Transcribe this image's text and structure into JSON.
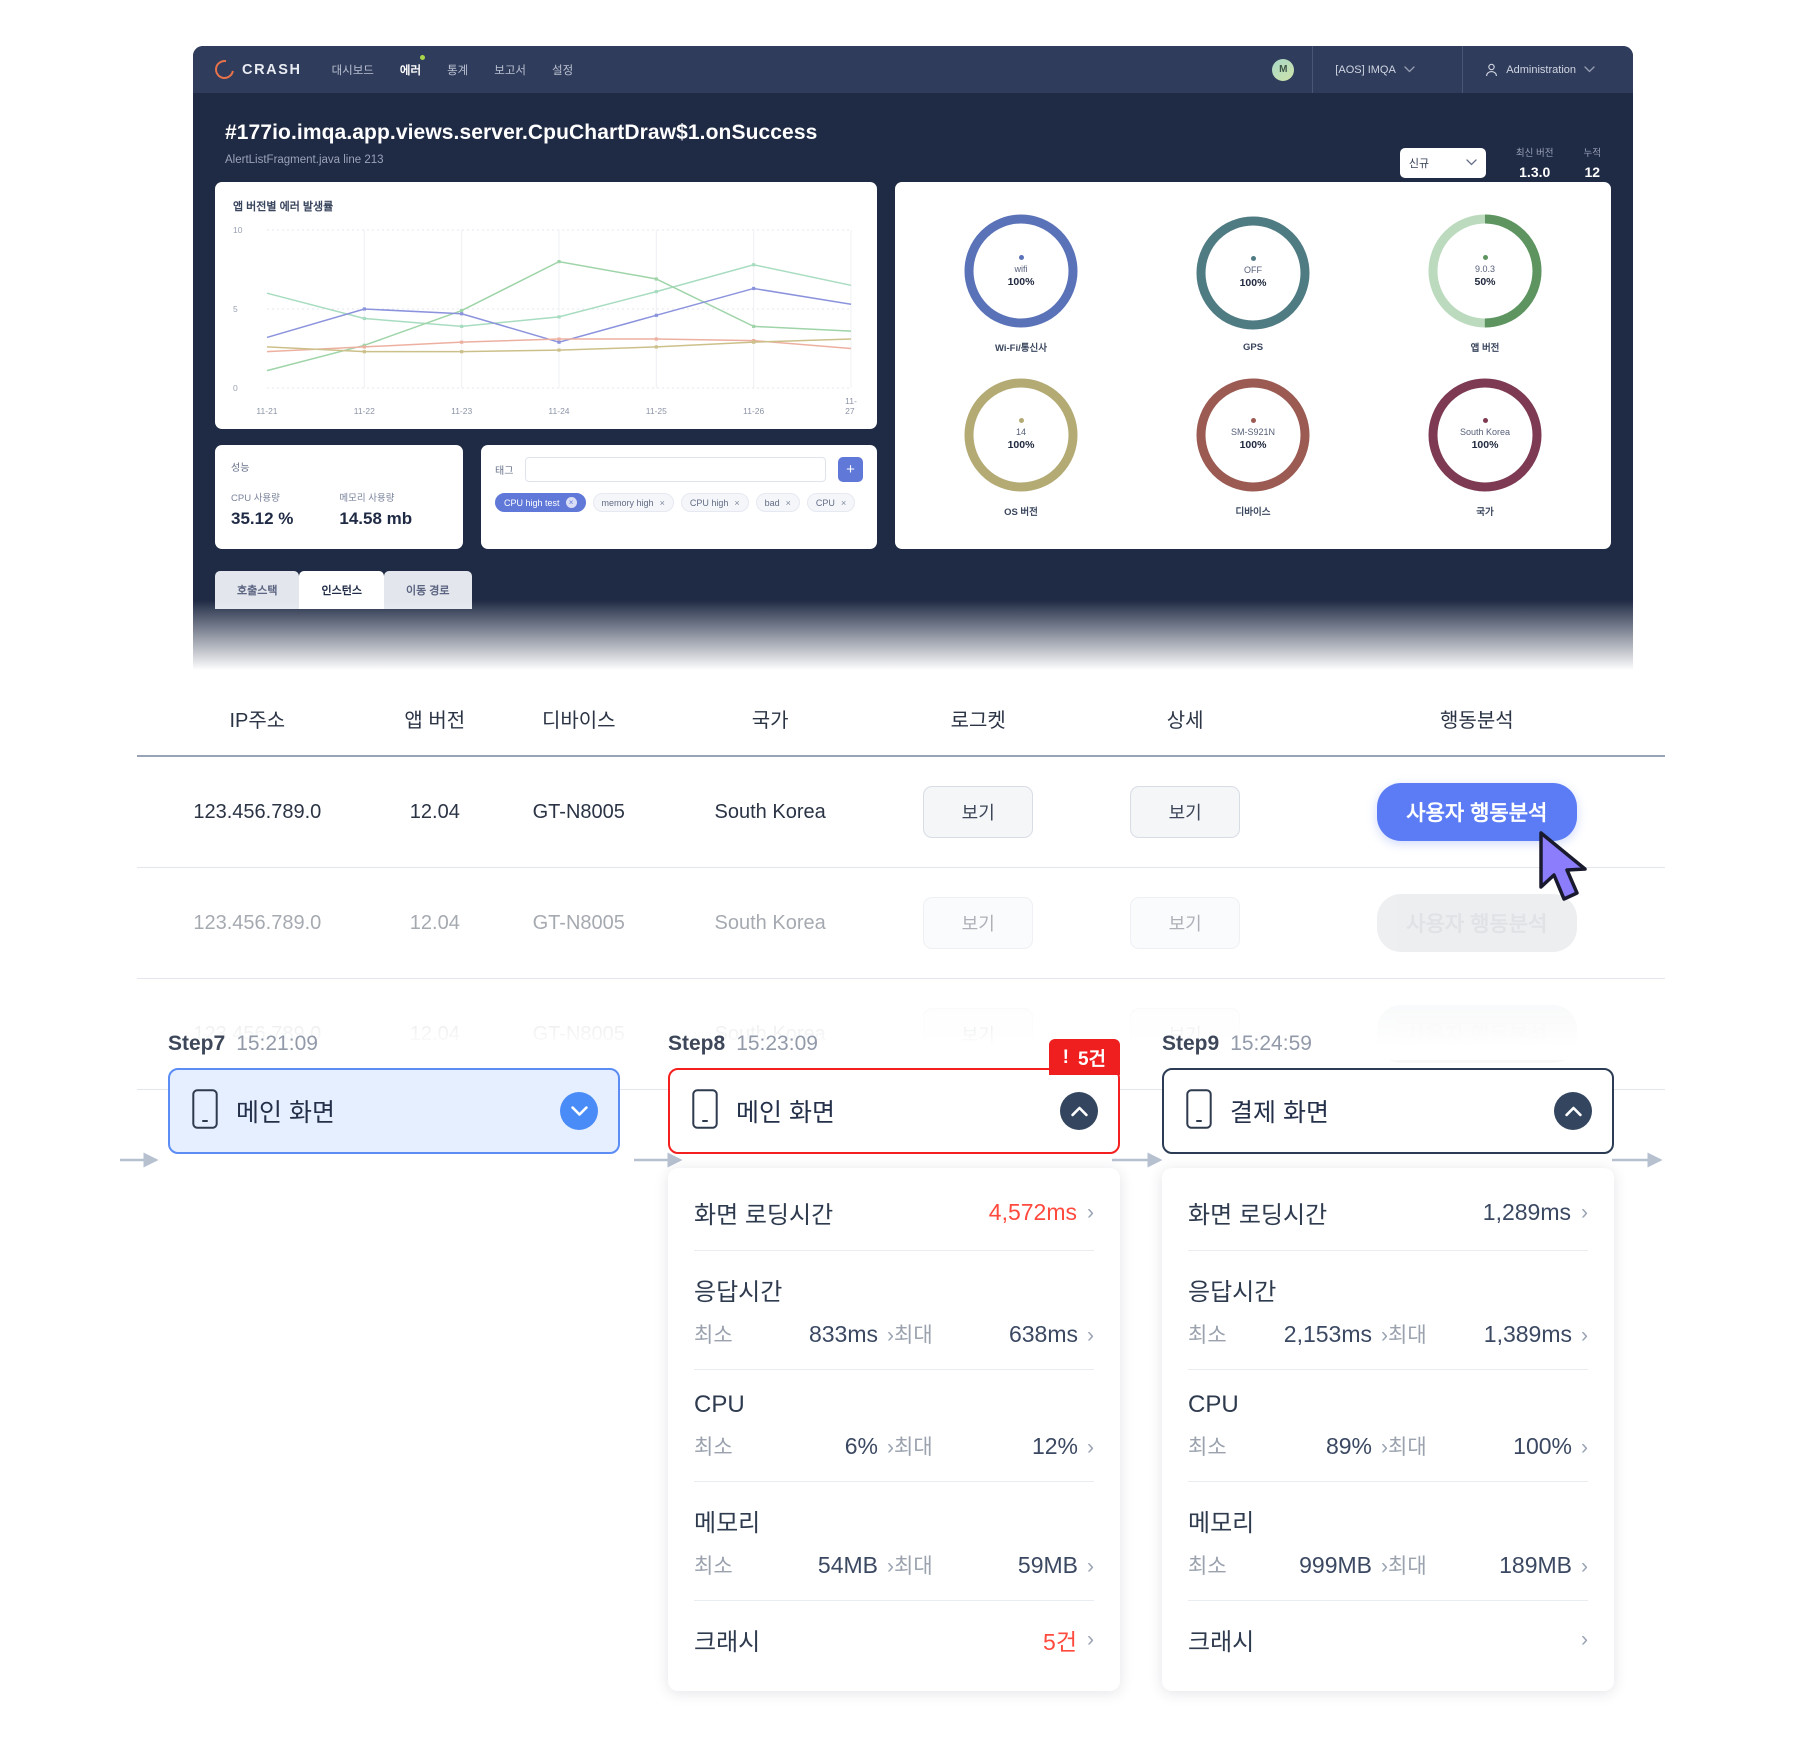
{
  "app": {
    "brand": "CRASH",
    "nav": [
      {
        "label": "대시보드",
        "active": false,
        "dot": false
      },
      {
        "label": "에러",
        "active": true,
        "dot": true
      },
      {
        "label": "통계",
        "active": false,
        "dot": false
      },
      {
        "label": "보고서",
        "active": false,
        "dot": false
      },
      {
        "label": "설정",
        "active": false,
        "dot": false
      }
    ],
    "avatar_initial": "M",
    "project_select": "[AOS] IMQA",
    "account_select": "Administration",
    "error_title": "#177io.imqa.app.views.server.CpuChartDraw$1.onSuccess",
    "error_sub": "AlertListFragment.java line 213",
    "status_select": "신규",
    "kpis": [
      {
        "label": "최신 버전",
        "value": "1.3.0"
      },
      {
        "label": "누적",
        "value": "12"
      }
    ]
  },
  "chart_data": {
    "type": "line",
    "title": "앱 버전별 에러 발생률",
    "xlabel": "",
    "ylabel": "",
    "categories": [
      "11-21",
      "11-22",
      "11-23",
      "11-24",
      "11-25",
      "11-26",
      "11-27"
    ],
    "ylim": [
      0,
      10
    ],
    "yticks": [
      0,
      5,
      10
    ],
    "grid": true,
    "legend": "none",
    "series": [
      {
        "name": "series-green-light",
        "color": "#a8dcc0",
        "values": [
          6.0,
          4.4,
          3.9,
          4.5,
          6.1,
          7.8,
          6.5
        ]
      },
      {
        "name": "series-green",
        "color": "#9ed4a8",
        "values": [
          1.1,
          2.7,
          4.9,
          8.0,
          6.9,
          3.9,
          3.6
        ]
      },
      {
        "name": "series-blue",
        "color": "#8b93dd",
        "values": [
          3.2,
          5.0,
          4.7,
          2.9,
          4.6,
          6.3,
          5.3
        ]
      },
      {
        "name": "series-salmon",
        "color": "#edb0a0",
        "values": [
          2.3,
          2.6,
          2.9,
          3.1,
          3.1,
          3.0,
          2.5
        ]
      },
      {
        "name": "series-olive",
        "color": "#ccc08a",
        "values": [
          2.6,
          2.3,
          2.3,
          2.4,
          2.6,
          2.9,
          3.1
        ]
      }
    ]
  },
  "performance": {
    "title": "성능",
    "metrics": [
      {
        "label": "CPU 사용량",
        "value": "35.12 %"
      },
      {
        "label": "메모리 사용량",
        "value": "14.58 mb"
      }
    ]
  },
  "tags": {
    "label": "태그",
    "input_value": "",
    "add_label": "+",
    "chips": [
      {
        "text": "CPU high test",
        "active": true
      },
      {
        "text": "memory high",
        "active": false
      },
      {
        "text": "CPU high",
        "active": false
      },
      {
        "text": "bad",
        "active": false
      },
      {
        "text": "CPU",
        "active": false
      }
    ]
  },
  "donuts": [
    {
      "name": "wifi",
      "pct": "100%",
      "label": "Wi-Fi/통신사",
      "color": "#5a72b8",
      "fill": 100
    },
    {
      "name": "OFF",
      "pct": "100%",
      "label": "GPS",
      "color": "#4f7b83",
      "fill": 100
    },
    {
      "name": "9.0.3",
      "pct": "50%",
      "label": "앱 버전",
      "color": "#5d9460",
      "track": "#bcdbbe",
      "fill": 50
    },
    {
      "name": "14",
      "pct": "100%",
      "label": "OS 버전",
      "color": "#b4ab74",
      "fill": 100
    },
    {
      "name": "SM-S921N",
      "pct": "100%",
      "label": "디바이스",
      "color": "#9b5a52",
      "fill": 100
    },
    {
      "name": "South Korea",
      "pct": "100%",
      "label": "국가",
      "color": "#7d3a52",
      "fill": 100
    }
  ],
  "tabs": [
    {
      "label": "호출스택",
      "active": false
    },
    {
      "label": "인스턴스",
      "active": true
    },
    {
      "label": "이동 경로",
      "active": false
    }
  ],
  "table": {
    "headers": [
      "IP주소",
      "앱 버전",
      "디바이스",
      "국가",
      "로그켓",
      "상세",
      "행동분석"
    ],
    "view_label": "보기",
    "action_label": "사용자 행동분석",
    "rows": [
      {
        "ip": "123.456.789.0",
        "version": "12.04",
        "device": "GT-N8005",
        "country": "South Korea",
        "fade": 0
      },
      {
        "ip": "123.456.789.0",
        "version": "12.04",
        "device": "GT-N8005",
        "country": "South Korea",
        "fade": 1
      },
      {
        "ip": "123.456.789.0",
        "version": "12.04",
        "device": "GT-N8005",
        "country": "South Korea",
        "fade": 2
      }
    ]
  },
  "flow": {
    "steps": [
      {
        "step": "Step7",
        "time": "15:21:09",
        "screen": "메인 화면",
        "state": "blue",
        "expanded": false,
        "toggle": "chevron-down",
        "badge": null,
        "details": null
      },
      {
        "step": "Step8",
        "time": "15:23:09",
        "screen": "메인 화면",
        "state": "red",
        "expanded": true,
        "toggle": "chevron-up",
        "badge": "5건",
        "badge_mark": "!",
        "details": {
          "loading_label": "화면 로딩시간",
          "loading_value": "4,572ms",
          "loading_alert": true,
          "response_label": "응답시간",
          "response_min_label": "최소",
          "response_min": "833ms",
          "response_max_label": "최대",
          "response_max": "638ms",
          "cpu_label": "CPU",
          "cpu_min_label": "최소",
          "cpu_min": "6%",
          "cpu_max_label": "최대",
          "cpu_max": "12%",
          "mem_label": "메모리",
          "mem_min_label": "최소",
          "mem_min": "54MB",
          "mem_max_label": "최대",
          "mem_max": "59MB",
          "crash_label": "크래시",
          "crash_value": "5건",
          "crash_alert": true
        }
      },
      {
        "step": "Step9",
        "time": "15:24:59",
        "screen": "결제 화면",
        "state": "navy",
        "expanded": true,
        "toggle": "chevron-up",
        "badge": null,
        "details": {
          "loading_label": "화면 로딩시간",
          "loading_value": "1,289ms",
          "loading_alert": false,
          "response_label": "응답시간",
          "response_min_label": "최소",
          "response_min": "2,153ms",
          "response_max_label": "최대",
          "response_max": "1,389ms",
          "cpu_label": "CPU",
          "cpu_min_label": "최소",
          "cpu_min": "89%",
          "cpu_max_label": "최대",
          "cpu_max": "100%",
          "mem_label": "메모리",
          "mem_min_label": "최소",
          "mem_min": "999MB",
          "mem_max_label": "최대",
          "mem_max": "189MB",
          "crash_label": "크래시",
          "crash_value": "",
          "crash_alert": false
        }
      }
    ]
  },
  "colors": {
    "accent": "#5b7cf5",
    "danger": "#ef1f1f",
    "navy": "#1f2a44"
  }
}
